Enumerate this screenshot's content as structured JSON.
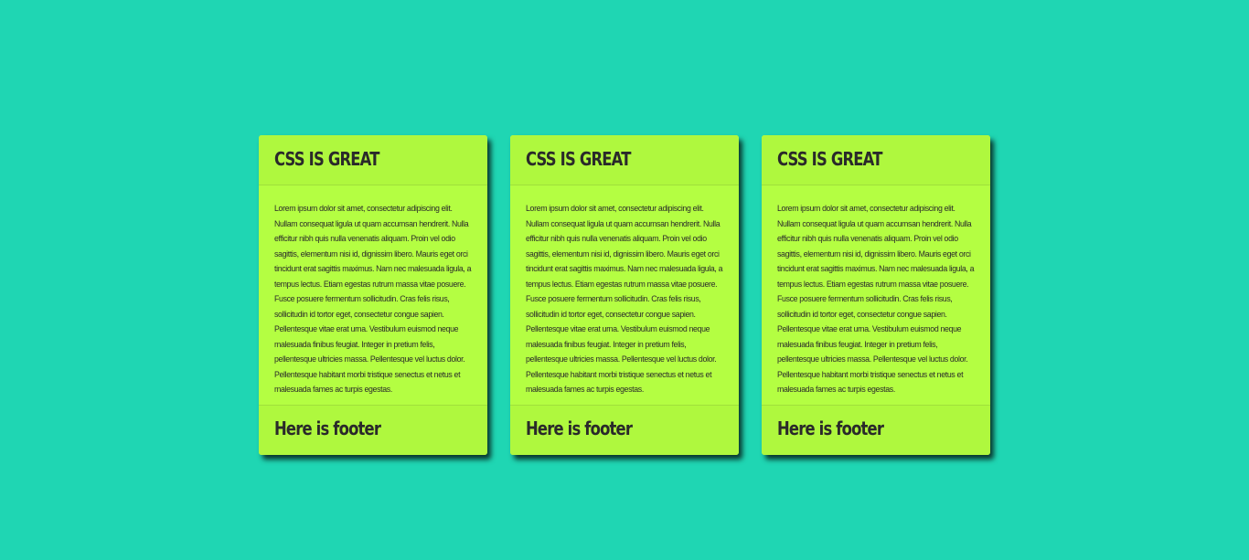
{
  "colors": {
    "background": "#1fd6b3",
    "card": "#b4fe42",
    "text": "#2a2a2a"
  },
  "cards": [
    {
      "title": "CSS IS GREAT",
      "body": "Lorem ipsum dolor sit amet, consectetur adipiscing elit. Nullam consequat ligula ut quam accumsan hendrerit. Nulla efficitur nibh quis nulla venenatis aliquam. Proin vel odio sagittis, elementum nisi id, dignissim libero. Mauris eget orci tincidunt erat sagittis maximus. Nam nec malesuada ligula, a tempus lectus. Etiam egestas rutrum massa vitae posuere. Fusce posuere fermentum sollicitudin. Cras felis risus, sollicitudin id tortor eget, consectetur congue sapien. Pellentesque vitae erat urna. Vestibulum euismod neque malesuada finibus feugiat. Integer in pretium felis, pellentesque ultricies massa. Pellentesque vel luctus dolor. Pellentesque habitant morbi tristique senectus et netus et malesuada fames ac turpis egestas.",
      "footer": "Here is footer"
    },
    {
      "title": "CSS IS GREAT",
      "body": "Lorem ipsum dolor sit amet, consectetur adipiscing elit. Nullam consequat ligula ut quam accumsan hendrerit. Nulla efficitur nibh quis nulla venenatis aliquam. Proin vel odio sagittis, elementum nisi id, dignissim libero. Mauris eget orci tincidunt erat sagittis maximus. Nam nec malesuada ligula, a tempus lectus. Etiam egestas rutrum massa vitae posuere. Fusce posuere fermentum sollicitudin. Cras felis risus, sollicitudin id tortor eget, consectetur congue sapien. Pellentesque vitae erat urna. Vestibulum euismod neque malesuada finibus feugiat. Integer in pretium felis, pellentesque ultricies massa. Pellentesque vel luctus dolor. Pellentesque habitant morbi tristique senectus et netus et malesuada fames ac turpis egestas.",
      "footer": "Here is footer"
    },
    {
      "title": "CSS IS GREAT",
      "body": "Lorem ipsum dolor sit amet, consectetur adipiscing elit. Nullam consequat ligula ut quam accumsan hendrerit. Nulla efficitur nibh quis nulla venenatis aliquam. Proin vel odio sagittis, elementum nisi id, dignissim libero. Mauris eget orci tincidunt erat sagittis maximus. Nam nec malesuada ligula, a tempus lectus. Etiam egestas rutrum massa vitae posuere. Fusce posuere fermentum sollicitudin. Cras felis risus, sollicitudin id tortor eget, consectetur congue sapien. Pellentesque vitae erat urna. Vestibulum euismod neque malesuada finibus feugiat. Integer in pretium felis, pellentesque ultricies massa. Pellentesque vel luctus dolor. Pellentesque habitant morbi tristique senectus et netus et malesuada fames ac turpis egestas.",
      "footer": "Here is footer"
    }
  ]
}
